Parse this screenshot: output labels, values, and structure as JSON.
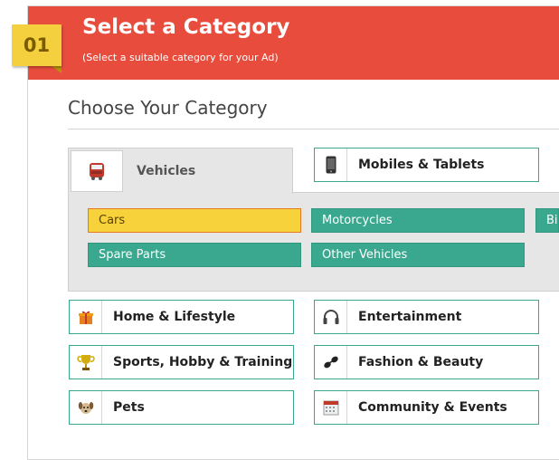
{
  "header": {
    "step": "01",
    "title": "Select a Category",
    "subtitle": "(Select a suitable category for your Ad)",
    "bg_color": "#e74c3c",
    "step_color": "#f4d03f"
  },
  "section_title": "Choose Your Category",
  "active_tab": {
    "label": "Vehicles",
    "icon": "bus-icon"
  },
  "subcategories": [
    {
      "label": "Cars",
      "selected": true
    },
    {
      "label": "Motorcycles",
      "selected": false
    },
    {
      "label": "Bicycles",
      "selected": false
    },
    {
      "label": "Spare Parts",
      "selected": false
    },
    {
      "label": "Other Vehicles",
      "selected": false
    }
  ],
  "categories": [
    {
      "label": "Mobiles & Tablets",
      "icon": "mobile-phone-icon"
    },
    {
      "label": "Home & Lifestyle",
      "icon": "gift-icon"
    },
    {
      "label": "Entertainment",
      "icon": "headphones-icon"
    },
    {
      "label": "Sports, Hobby & Training",
      "icon": "trophy-icon"
    },
    {
      "label": "Fashion & Beauty",
      "icon": "sunglasses-icon"
    },
    {
      "label": "Pets",
      "icon": "dog-icon"
    },
    {
      "label": "Community & Events",
      "icon": "calendar-icon"
    }
  ],
  "colors": {
    "accent_green": "#3aa88f",
    "selected_yellow": "#f8d23b",
    "selected_border": "#e57a23"
  }
}
